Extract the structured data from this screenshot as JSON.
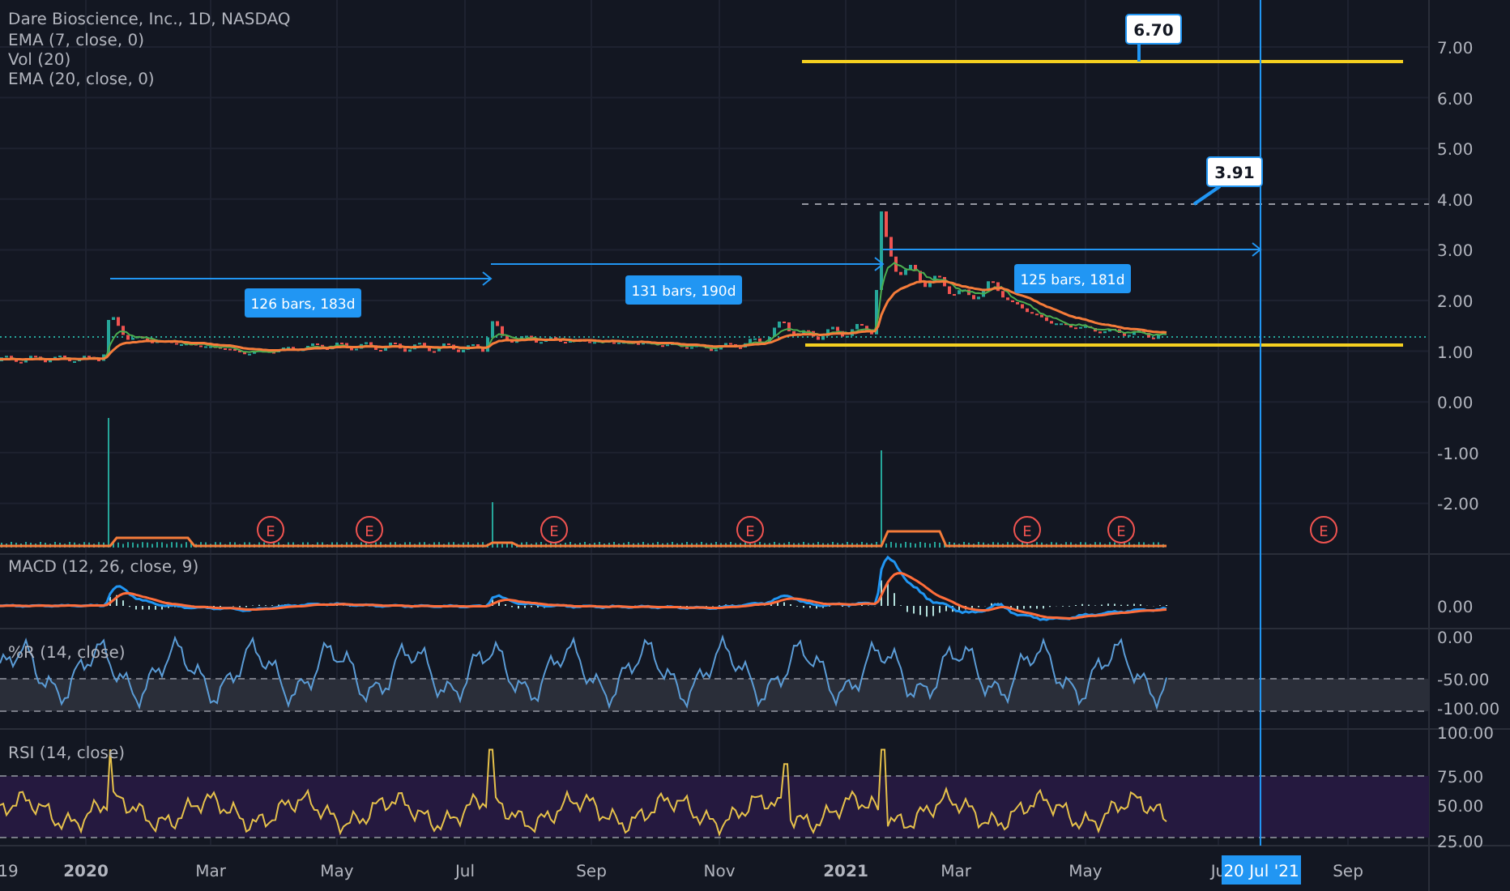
{
  "header": {
    "title": "Dare Bioscience, Inc., 1D, NASDAQ",
    "indicators": [
      "EMA (7, close, 0)",
      "Vol (20)",
      "EMA (20, close, 0)"
    ]
  },
  "price_axis": {
    "labels": [
      "7.00",
      "6.00",
      "5.00",
      "4.00",
      "3.00",
      "2.00",
      "1.00",
      "0.00",
      "-1.00",
      "-2.00"
    ]
  },
  "price_labels": [
    "6.70",
    "3.91"
  ],
  "date_ranges": [
    "126 bars, 183d",
    "131 bars, 190d",
    "125 bars, 181d"
  ],
  "earnings_markers": [
    "E",
    "E",
    "E",
    "E",
    "E",
    "E",
    "E"
  ],
  "panes": [
    {
      "title": "MACD (12, 26, close, 9)",
      "axis_labels": [
        "0.00"
      ]
    },
    {
      "title": "%R (14, close)",
      "axis_labels": [
        "0.00",
        "-50.00",
        "-100.00"
      ]
    },
    {
      "title": "RSI (14, close)",
      "axis_labels": [
        "100.00",
        "75.00",
        "50.00",
        "25.00"
      ]
    }
  ],
  "time_axis": {
    "labels": [
      "19",
      "2020",
      "Mar",
      "May",
      "Jul",
      "Sep",
      "Nov",
      "2021",
      "Mar",
      "May",
      "Ju",
      "Sep"
    ],
    "crosshair_label": "20 Jul '21"
  }
}
